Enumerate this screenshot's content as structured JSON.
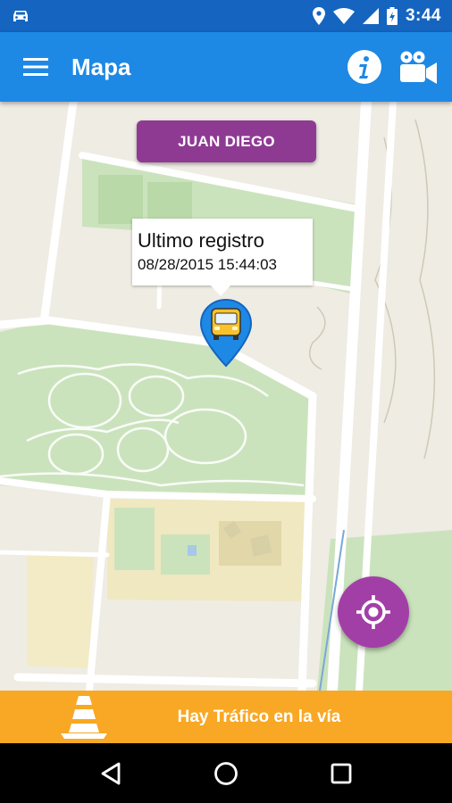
{
  "status_bar": {
    "time": "3:44",
    "icons": [
      "car-icon",
      "location-icon",
      "wifi-icon",
      "signal-icon",
      "battery-charging-icon"
    ]
  },
  "app_bar": {
    "title": "Mapa",
    "left_icon": "menu-icon",
    "right_icons": [
      "info-icon",
      "video-camera-icon"
    ]
  },
  "map": {
    "route_chip_label": "JUAN DIEGO",
    "info_window": {
      "title": "Ultimo registro",
      "datetime": "08/28/2015 15:44:03"
    },
    "marker_icon": "bus-icon",
    "fab_icon": "my-location-icon",
    "colors": {
      "park": "#cbe3bd",
      "campus": "#f0e8c0",
      "roads": "#ffffff",
      "background": "#efece4"
    }
  },
  "traffic_bar": {
    "label": "Hay Tráfico en la vía",
    "icon": "traffic-cone-icon",
    "color": "#f8a824"
  },
  "nav_bar": {
    "icons": [
      "back-icon",
      "home-icon",
      "recents-icon"
    ]
  },
  "colors": {
    "status_bar": "#1565c0",
    "app_bar": "#1e88e5",
    "accent": "#a23fa7",
    "chip": "#8e3a93"
  }
}
